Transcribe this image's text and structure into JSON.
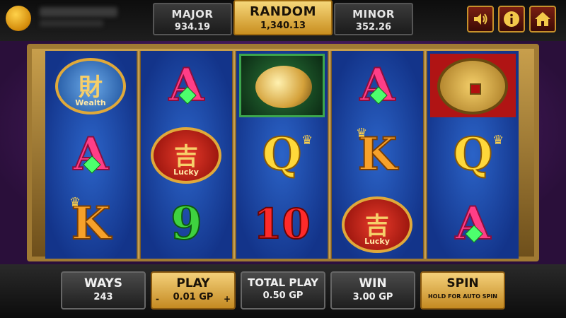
{
  "jackpots": {
    "major": {
      "label": "MAJOR",
      "value": "934.19"
    },
    "random": {
      "label": "RANDOM",
      "value": "1,340.13"
    },
    "minor": {
      "label": "MINOR",
      "value": "352.26"
    }
  },
  "top_buttons": {
    "sound_icon": "speaker-icon",
    "info_icon": "info-icon",
    "home_icon": "home-icon"
  },
  "reels": [
    [
      {
        "symbol": "wealth",
        "label": "Wealth",
        "glyph": "財"
      },
      {
        "symbol": "A"
      },
      {
        "symbol": "K"
      }
    ],
    [
      {
        "symbol": "A"
      },
      {
        "symbol": "lucky",
        "label": "Lucky",
        "glyph": "吉"
      },
      {
        "symbol": "9"
      }
    ],
    [
      {
        "symbol": "fish"
      },
      {
        "symbol": "Q"
      },
      {
        "symbol": "10"
      }
    ],
    [
      {
        "symbol": "A"
      },
      {
        "symbol": "K"
      },
      {
        "symbol": "lucky",
        "label": "Lucky",
        "glyph": "吉"
      }
    ],
    [
      {
        "symbol": "coin"
      },
      {
        "symbol": "Q"
      },
      {
        "symbol": "A"
      }
    ]
  ],
  "controls": {
    "ways": {
      "label": "WAYS",
      "value": "243"
    },
    "play": {
      "label": "PLAY",
      "value": "0.01 GP",
      "minus": "-",
      "plus": "+"
    },
    "total_play": {
      "label": "TOTAL PLAY",
      "value": "0.50 GP"
    },
    "win": {
      "label": "WIN",
      "value": "3.00 GP"
    },
    "spin": {
      "label": "SPIN",
      "sub": "HOLD FOR AUTO SPIN"
    }
  },
  "colors": {
    "accent_gold": "#c98f20",
    "reel_blue": "#1f4fb0",
    "frame_gold": "#a07a33"
  }
}
